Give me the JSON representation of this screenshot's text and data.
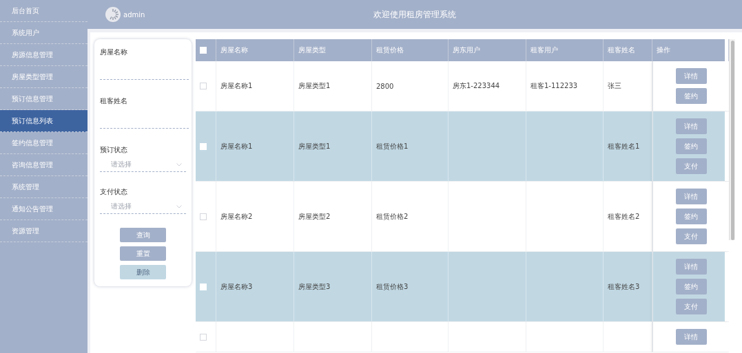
{
  "sidebar": {
    "items": [
      {
        "label": "后台首页",
        "selected": false
      },
      {
        "label": "系统用户",
        "selected": false
      },
      {
        "label": "房源信息管理",
        "selected": false
      },
      {
        "label": "房屋类型管理",
        "selected": false
      },
      {
        "label": "预订信息管理",
        "selected": false
      },
      {
        "label": "预订信息列表",
        "selected": true
      },
      {
        "label": "签约信息管理",
        "selected": false
      },
      {
        "label": "咨询信息管理",
        "selected": false
      },
      {
        "label": "系统管理",
        "selected": false
      },
      {
        "label": "通知公告管理",
        "selected": false
      },
      {
        "label": "资源管理",
        "selected": false
      }
    ]
  },
  "header": {
    "user": "admin",
    "title": "欢迎使用租房管理系统"
  },
  "filter": {
    "fields": [
      {
        "kind": "text",
        "label": "房屋名称"
      },
      {
        "kind": "text",
        "label": "租客姓名"
      },
      {
        "kind": "select",
        "label": "预订状态",
        "placeholder": "请选择"
      },
      {
        "kind": "select",
        "label": "支付状态",
        "placeholder": "请选择"
      }
    ],
    "buttons": [
      {
        "label": "查询",
        "disabled": false
      },
      {
        "label": "重置",
        "disabled": false
      },
      {
        "label": "删除",
        "disabled": true
      }
    ]
  },
  "table": {
    "columns": [
      "房屋名称",
      "房屋类型",
      "租赁价格",
      "房东用户",
      "租客用户",
      "租客姓名",
      "操作"
    ],
    "header_checked": false,
    "rows": [
      {
        "checked": false,
        "cells": [
          "房屋名称1",
          "房屋类型1",
          "2800",
          "房东1-223344",
          "租客1-112233",
          "张三"
        ],
        "actions": [
          "详情",
          "签约"
        ]
      },
      {
        "checked": false,
        "cells": [
          "房屋名称1",
          "房屋类型1",
          "租赁价格1",
          "",
          "",
          "租客姓名1"
        ],
        "actions": [
          "详情",
          "签约",
          "支付"
        ]
      },
      {
        "checked": false,
        "cells": [
          "房屋名称2",
          "房屋类型2",
          "租赁价格2",
          "",
          "",
          "租客姓名2"
        ],
        "actions": [
          "详情",
          "签约",
          "支付"
        ]
      },
      {
        "checked": false,
        "cells": [
          "房屋名称3",
          "房屋类型3",
          "租赁价格3",
          "",
          "",
          "租客姓名3"
        ],
        "actions": [
          "详情",
          "签约",
          "支付"
        ]
      },
      {
        "checked": false,
        "cells": [
          "",
          "",
          "",
          "",
          "",
          ""
        ],
        "actions": [
          "详情"
        ]
      }
    ]
  }
}
